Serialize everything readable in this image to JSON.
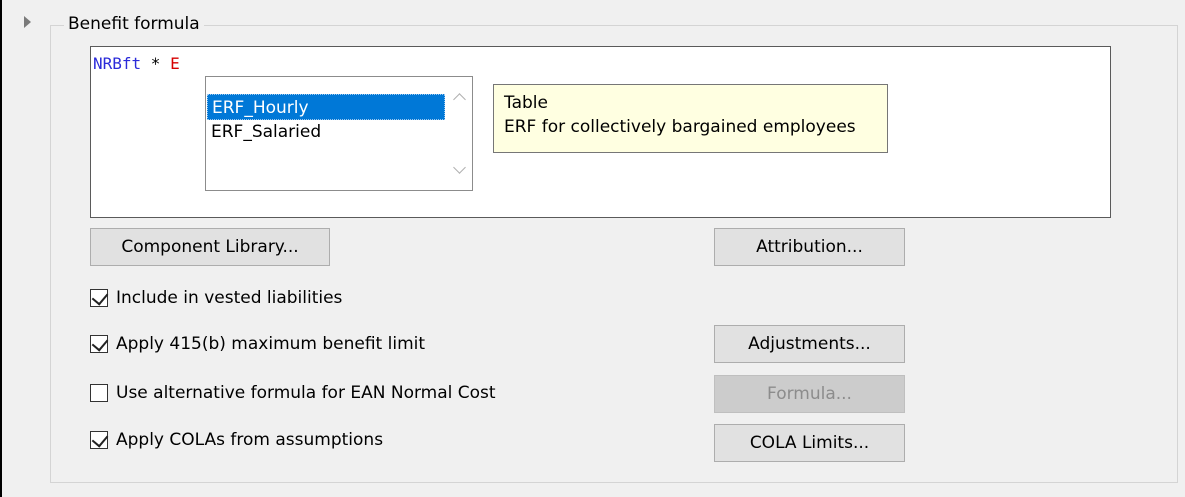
{
  "group": {
    "title": "Benefit formula"
  },
  "editor": {
    "tokens": {
      "ident": "NRBft",
      "op": " * ",
      "var": "E"
    },
    "autocomplete": {
      "items": [
        "ERF_Hourly",
        "ERF_Salaried"
      ],
      "selected_index": 0
    },
    "tooltip": {
      "line1": "Table",
      "line2": "ERF for collectively bargained employees"
    }
  },
  "buttons": {
    "component_library": "Component Library...",
    "attribution": "Attribution...",
    "adjustments": "Adjustments...",
    "formula": "Formula...",
    "cola_limits": "COLA Limits..."
  },
  "checkboxes": [
    {
      "label": "Include in vested liabilities",
      "checked": true
    },
    {
      "label": "Apply 415(b) maximum benefit limit",
      "checked": true
    },
    {
      "label": "Use alternative formula for EAN Normal Cost",
      "checked": false
    },
    {
      "label": "Apply COLAs from assumptions",
      "checked": true
    }
  ],
  "colors": {
    "selection": "#0078d7",
    "tooltip_bg": "#ffffe1",
    "ident": "#2b2bd9",
    "variable": "#d60000"
  }
}
